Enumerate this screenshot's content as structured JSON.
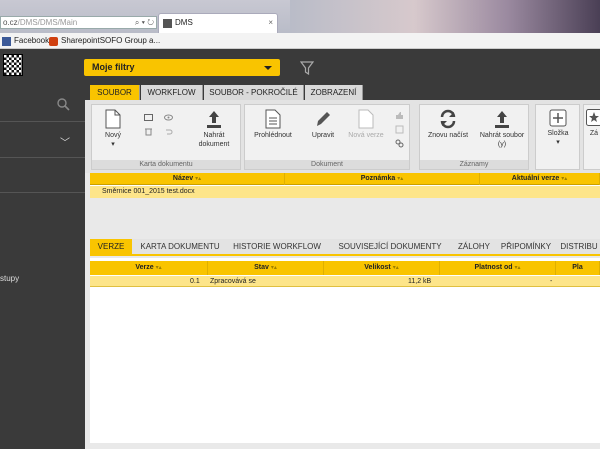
{
  "browser": {
    "url_host": "o.cz",
    "url_path": "/DMS/DMS/Main",
    "tab_title": "DMS",
    "tab_close": "×",
    "bookmarks": [
      "Facebook",
      "SharepointSOFO Group a..."
    ]
  },
  "header": {
    "filter_label": "Moje filtry"
  },
  "sidebar": {
    "partial_text": "stupy"
  },
  "ribbon": {
    "tabs": [
      "SOUBOR",
      "WORKFLOW",
      "SOUBOR - POKROČILÉ",
      "ZOBRAZENÍ"
    ],
    "active_tab": "SOUBOR",
    "groups": {
      "karta": {
        "label": "Karta dokumentu",
        "new": "Nový",
        "upload": "Nahrát dokument"
      },
      "dokument": {
        "label": "Dokument",
        "view": "Prohlédnout",
        "edit": "Upravit",
        "new_version": "Nová verze"
      },
      "zaznamy": {
        "label": "Záznamy",
        "reload": "Znovu načíst",
        "upload_files": "Nahrát soubor (y)"
      },
      "slozka": {
        "label": "Složka"
      },
      "partial": {
        "label": "Zá"
      }
    }
  },
  "grid": {
    "columns": [
      "Název",
      "Poznámka",
      "Aktuální verze"
    ],
    "rows": [
      {
        "name": "Směrnice 001_2015 test.docx",
        "note": "",
        "version": ""
      }
    ]
  },
  "detail": {
    "tabs": [
      "VERZE",
      "KARTA DOKUMENTU",
      "HISTORIE WORKFLOW",
      "SOUVISEJÍCÍ DOKUMENTY",
      "ZÁLOHY",
      "PŘIPOMÍNKY",
      "DISTRIBU"
    ],
    "active_tab": "VERZE",
    "columns": [
      "Verze",
      "Stav",
      "Velikost",
      "Platnost od",
      "Pla"
    ],
    "rows": [
      {
        "version": "0.1",
        "state": "Zpracovává se",
        "size": "11,2 kB",
        "valid_from": "-"
      }
    ]
  },
  "colors": {
    "accent": "#f9c400",
    "dark": "#3a3a3a"
  }
}
